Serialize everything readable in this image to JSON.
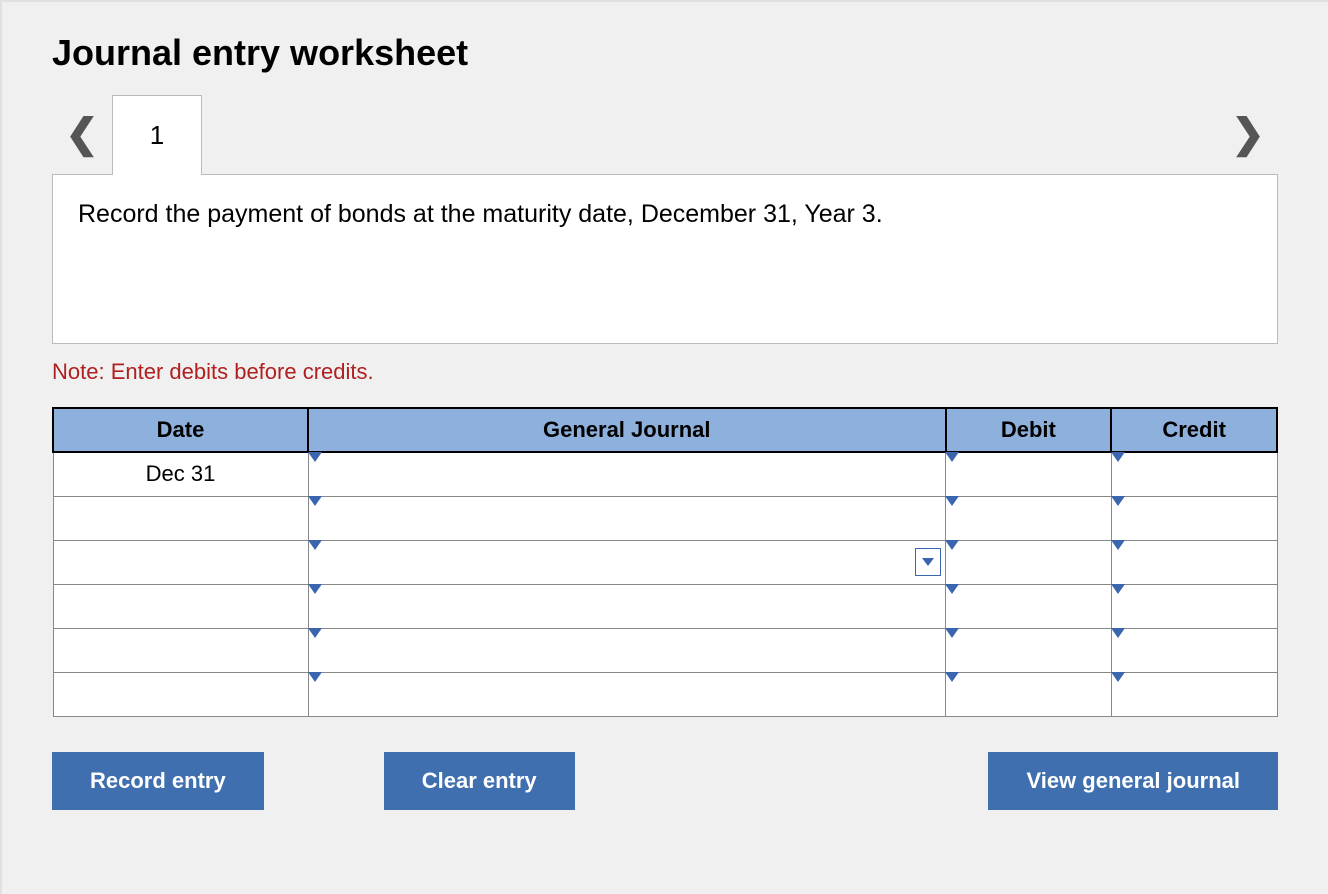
{
  "title": "Journal entry worksheet",
  "tabs": [
    "1"
  ],
  "instruction": "Record the payment of bonds at the maturity date, December 31, Year 3.",
  "note": "Note: Enter debits before credits.",
  "table": {
    "headers": {
      "date": "Date",
      "gj": "General Journal",
      "debit": "Debit",
      "credit": "Credit"
    },
    "rows": [
      {
        "date": "Dec 31",
        "gj": "",
        "debit": "",
        "credit": "",
        "showDropdown": false
      },
      {
        "date": "",
        "gj": "",
        "debit": "",
        "credit": "",
        "showDropdown": false
      },
      {
        "date": "",
        "gj": "",
        "debit": "",
        "credit": "",
        "showDropdown": true
      },
      {
        "date": "",
        "gj": "",
        "debit": "",
        "credit": "",
        "showDropdown": false
      },
      {
        "date": "",
        "gj": "",
        "debit": "",
        "credit": "",
        "showDropdown": false
      },
      {
        "date": "",
        "gj": "",
        "debit": "",
        "credit": "",
        "showDropdown": false
      }
    ]
  },
  "buttons": {
    "record": "Record entry",
    "clear": "Clear entry",
    "view": "View general journal"
  }
}
